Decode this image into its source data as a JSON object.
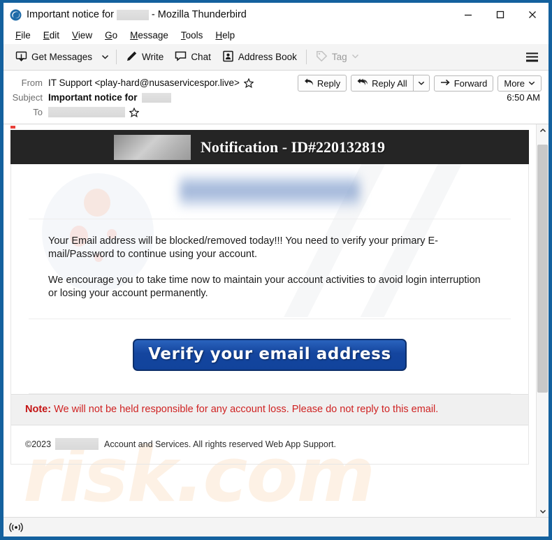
{
  "window": {
    "title_prefix": "Important notice for",
    "title_suffix": "- Mozilla Thunderbird",
    "app_icon": "thunderbird-icon",
    "minimize_label": "—",
    "maximize_label": "□",
    "close_label": "✕",
    "frame_color": "#14619e"
  },
  "menubar": {
    "items": [
      {
        "label": "File",
        "accel": "F"
      },
      {
        "label": "Edit",
        "accel": "E"
      },
      {
        "label": "View",
        "accel": "V"
      },
      {
        "label": "Go",
        "accel": "G"
      },
      {
        "label": "Message",
        "accel": "M"
      },
      {
        "label": "Tools",
        "accel": "T"
      },
      {
        "label": "Help",
        "accel": "H"
      }
    ]
  },
  "toolbar": {
    "get_messages_label": "Get Messages",
    "write_label": "Write",
    "chat_label": "Chat",
    "address_book_label": "Address Book",
    "tag_label": "Tag",
    "tag_disabled": true,
    "menu_label": "app-menu"
  },
  "message_header": {
    "from_label": "From",
    "from_value": "IT Support <play-hard@nusaservicespor.live>",
    "subject_label": "Subject",
    "subject_value": "Important notice for",
    "subject_redacted": true,
    "to_label": "To",
    "to_value": "",
    "to_redacted": true,
    "timestamp": "6:50 AM",
    "actions": {
      "reply": "Reply",
      "reply_all": "Reply All",
      "forward": "Forward",
      "more": "More"
    }
  },
  "email": {
    "banner": {
      "logo": "redacted-brand-logo",
      "title": "Notification - ID#220132819",
      "background": "#252525"
    },
    "hero_logo": "blurred-brand-wordmark",
    "paragraphs": [
      "Your Email address  will be blocked/removed today!!! You need to verify your primary E-mail/Password to continue using your account.",
      "We encourage you to take time now to maintain your account activities to avoid login interruption or losing your account permanently."
    ],
    "cta_label": "Verify your email address",
    "cta_color": "#14459e",
    "note_prefix": "Note:",
    "note_text": " We will not be held responsible for any account loss. Please do not reply to this email.",
    "note_color": "#cf2222",
    "footer_copyright": "©2023",
    "footer_brand_redacted": true,
    "footer_text": "Account and Services. All rights reserved Web App Support."
  },
  "watermark": {
    "text": "risk.com"
  },
  "statusbar": {
    "icon": "broadcast-icon",
    "text": ""
  }
}
